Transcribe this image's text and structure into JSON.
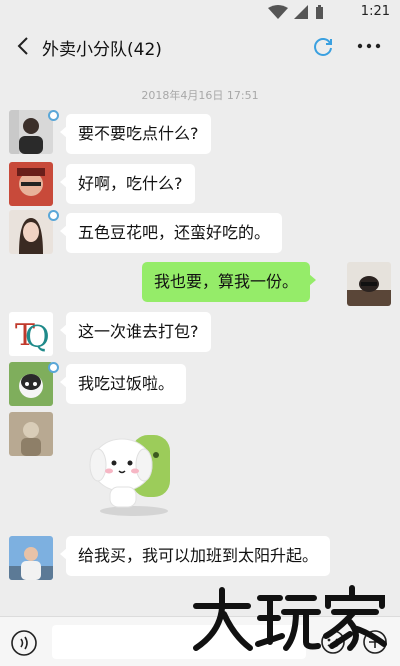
{
  "status_bar": {
    "time": "1:21"
  },
  "header": {
    "title": "外卖小分队(42)"
  },
  "chat": {
    "timestamp": "2018年4月16日 17:51",
    "messages": [
      {
        "side": "left",
        "text": "要不要吃点什么?"
      },
      {
        "side": "left",
        "text": "好啊，吃什么?"
      },
      {
        "side": "left",
        "text": "五色豆花吧，还蛮好吃的。"
      },
      {
        "side": "right",
        "text": "我也要，算我一份。"
      },
      {
        "side": "left",
        "text": "这一次谁去打包?"
      },
      {
        "side": "left",
        "text": "我吃过饭啦。"
      },
      {
        "side": "left",
        "text": ""
      },
      {
        "side": "left",
        "text": "给我买，我可以加班到太阳升起。"
      }
    ]
  },
  "avatar_labels": {
    "letters": "TQ"
  },
  "watermark": {
    "text": "大玩家"
  },
  "colors": {
    "outgoing_bubble": "#95ec69",
    "incoming_bubble": "#ffffff",
    "background": "#ededed"
  },
  "icons": [
    "back-arrow-icon",
    "sync-icon",
    "more-icon",
    "voice-icon",
    "emoji-icon",
    "plus-icon",
    "wifi-icon",
    "signal-icon",
    "battery-icon"
  ]
}
